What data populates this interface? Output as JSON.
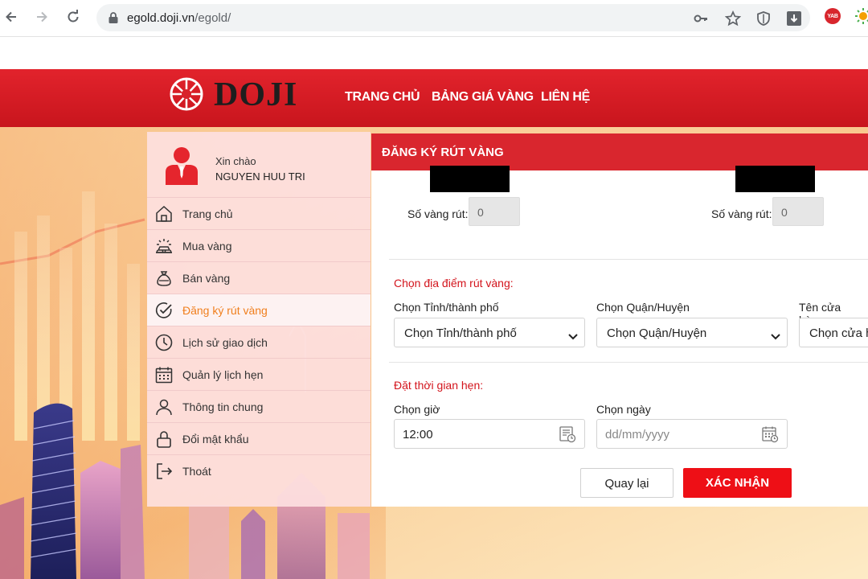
{
  "browser": {
    "url_host": "egold.doji.vn",
    "url_path": "/egold/",
    "ext_badge": "YAB"
  },
  "header": {
    "brand": "DOJI",
    "nav": [
      "TRANG CHỦ",
      "BẢNG GIÁ VÀNG",
      "LIÊN HỆ"
    ]
  },
  "sidebar": {
    "greeting": "Xin chào",
    "username": "NGUYEN HUU TRI",
    "items": [
      {
        "label": "Trang chủ",
        "icon": "home-icon"
      },
      {
        "label": "Mua vàng",
        "icon": "gold-bars-icon"
      },
      {
        "label": "Bán vàng",
        "icon": "money-bag-icon"
      },
      {
        "label": "Đăng ký rút vàng",
        "icon": "check-circle-icon",
        "active": true
      },
      {
        "label": "Lịch sử giao dịch",
        "icon": "clock-icon"
      },
      {
        "label": "Quản lý lịch hẹn",
        "icon": "calendar-icon"
      },
      {
        "label": "Thông tin chung",
        "icon": "user-icon"
      },
      {
        "label": "Đổi mật khẩu",
        "icon": "lock-icon"
      },
      {
        "label": "Thoát",
        "icon": "logout-icon"
      }
    ]
  },
  "panel": {
    "title": "ĐĂNG KÝ RÚT VÀNG",
    "amount_label_1": "Số vàng rút:",
    "amount_value_1": "0",
    "amount_label_2": "Số vàng rút:",
    "amount_value_2": "0",
    "location_section": "Chọn địa điểm rút vàng:",
    "province_label": "Chọn Tỉnh/thành phố",
    "province_value": "Chọn Tỉnh/thành phố",
    "district_label": "Chọn Quận/Huyện",
    "district_value": "Chọn Quận/Huyện",
    "store_label": "Tên cửa hàng",
    "store_value": "Chọn cửa hàng",
    "time_section": "Đặt thời gian hẹn:",
    "time_label": "Chọn giờ",
    "time_value": "12:00",
    "date_label": "Chọn ngày",
    "date_placeholder": "dd/mm/yyyy",
    "back_label": "Quay lại",
    "confirm_label": "XÁC NHẬN"
  },
  "colors": {
    "brand_red": "#d9262e",
    "confirm_red": "#ee0f16",
    "active_orange": "#f07f1d",
    "section_red": "#d3141c"
  }
}
